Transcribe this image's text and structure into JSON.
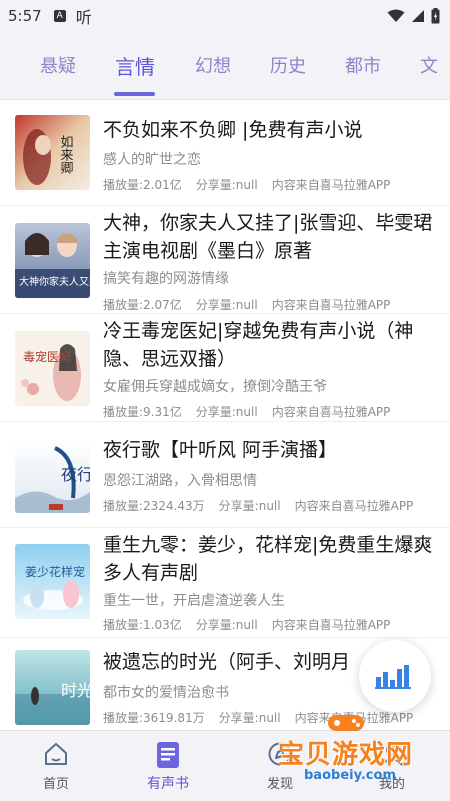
{
  "status_bar": {
    "time": "5:57",
    "notification_glyph": "听"
  },
  "tabs": [
    {
      "label": "悬疑",
      "active": false
    },
    {
      "label": "言情",
      "active": true
    },
    {
      "label": "幻想",
      "active": false
    },
    {
      "label": "历史",
      "active": false
    },
    {
      "label": "都市",
      "active": false
    },
    {
      "label": "文",
      "active": false
    }
  ],
  "items": [
    {
      "title": "不负如来不负卿 |免费有声小说",
      "desc": "感人的旷世之恋",
      "plays": "播放量:2.01亿",
      "shares": "分享量:null",
      "source": "内容来自喜马拉雅APP",
      "cover_text": "如来卿"
    },
    {
      "title": "大神，你家夫人又挂了|张雪迎、毕雯珺主演电视剧《墨白》原著",
      "desc": "搞笑有趣的网游情缘",
      "plays": "播放量:2.07亿",
      "shares": "分享量:null",
      "source": "内容来自喜马拉雅APP",
      "cover_text": "大神你家夫人又挂了"
    },
    {
      "title": "冷王毒宠医妃|穿越免费有声小说（神隐、思远双播）",
      "desc": "女雇佣兵穿越成嫡女，撩倒冷酷王爷",
      "plays": "播放量:9.31亿",
      "shares": "分享量:null",
      "source": "内容来自喜马拉雅APP",
      "cover_text": "毒宠医妃"
    },
    {
      "title": "夜行歌【叶听风 阿手演播】",
      "desc": "恩怨江湖路，入骨相思情",
      "plays": "播放量:2324.43万",
      "shares": "分享量:null",
      "source": "内容来自喜马拉雅APP",
      "cover_text": "夜行歌"
    },
    {
      "title": "重生九零：姜少，花样宠|免费重生爆爽多人有声剧",
      "desc": "重生一世，开启虐渣逆袭人生",
      "plays": "播放量:1.03亿",
      "shares": "分享量:null",
      "source": "内容来自喜马拉雅APP",
      "cover_text": "姜少花样宠"
    },
    {
      "title": "被遗忘的时光（阿手、刘明月",
      "desc": "都市女的爱情治愈书",
      "plays": "播放量:3619.81万",
      "shares": "分享量:null",
      "source": "内容来自喜马拉雅APP",
      "cover_text": "时光"
    }
  ],
  "bottom_nav": [
    {
      "label": "首页",
      "icon": "home-icon",
      "active": false
    },
    {
      "label": "有声书",
      "icon": "audiobook-icon",
      "active": true
    },
    {
      "label": "发现",
      "icon": "discover-icon",
      "active": false
    },
    {
      "label": "我的",
      "icon": "profile-icon",
      "active": false
    }
  ],
  "watermark": {
    "text": "宝贝游戏网",
    "sub": "baobeiy.com"
  },
  "colors": {
    "accent": "#5c57d6",
    "tab_inactive": "#8a87c8",
    "fab_bars": "#3b82e6",
    "watermark_orange": "#f5821f"
  }
}
